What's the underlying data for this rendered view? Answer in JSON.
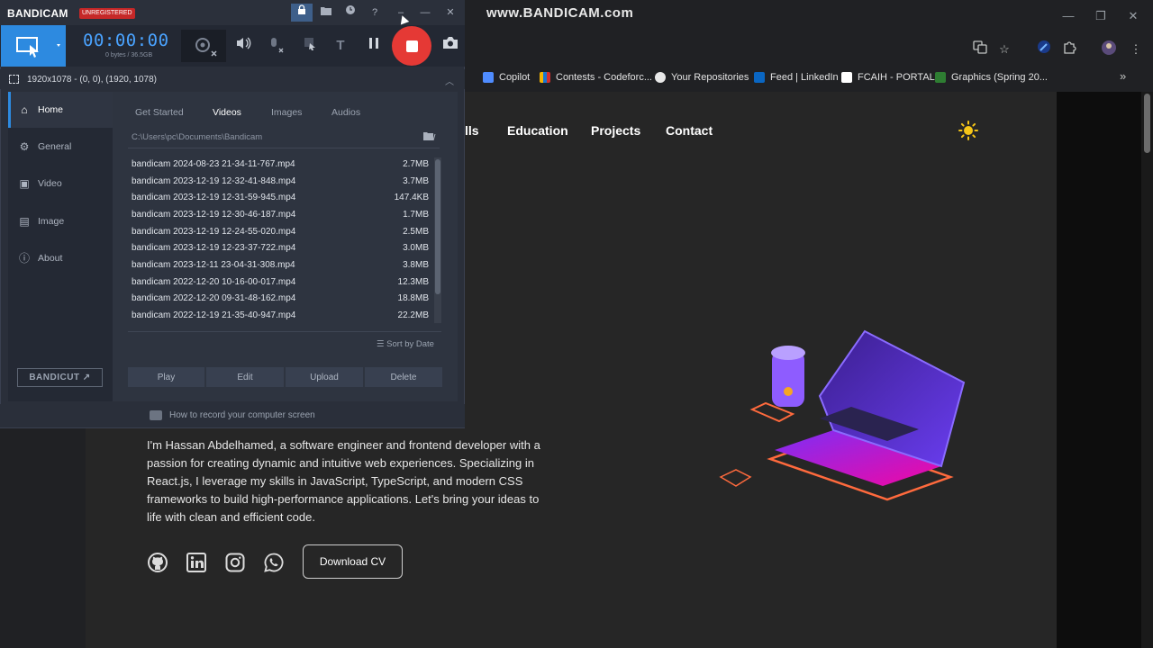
{
  "browser": {
    "watermark": "www.BANDICAM.com",
    "window_controls": [
      "—",
      "❐",
      "✕"
    ],
    "bookmarks": [
      {
        "label": "Copilot",
        "color": "#4f8cff"
      },
      {
        "label": "Contests - Codeforc...",
        "color": "#f5b400"
      },
      {
        "label": "Your Repositories",
        "color": "#e8e8e8"
      },
      {
        "label": "Feed | LinkedIn",
        "color": "#0a66c2"
      },
      {
        "label": "FCAIH - PORTAL",
        "color": "#ffffff"
      },
      {
        "label": "Graphics (Spring 20...",
        "color": "#2e7d32"
      }
    ],
    "bookmarks_more": "»"
  },
  "portfolio": {
    "nav": [
      "lls",
      "Education",
      "Projects",
      "Contact"
    ],
    "bio": "I'm Hassan Abdelhamed, a software engineer and frontend developer with a passion for creating dynamic and intuitive web experiences. Specializing in React.js, I leverage my skills in JavaScript, TypeScript, and modern CSS frameworks to build high-performance applications. Let's bring your ideas to life with clean and efficient code.",
    "social_icons": [
      "github-icon",
      "linkedin-icon",
      "instagram-icon",
      "whatsapp-icon"
    ],
    "download_label": "Download CV",
    "accent_color": "#f5c518"
  },
  "bandicam": {
    "logo": "BANDICAM",
    "unregistered": "UNREGISTERED",
    "timer": "00:00:00",
    "size": "0 bytes / 36.5GB",
    "area_label": "1920x1078 - (0, 0), (1920, 1078)",
    "sidebar": [
      {
        "label": "Home",
        "icon": "home-icon",
        "glyph": "⌂"
      },
      {
        "label": "General",
        "icon": "gear-icon",
        "glyph": "⚙"
      },
      {
        "label": "Video",
        "icon": "video-icon",
        "glyph": "▣"
      },
      {
        "label": "Image",
        "icon": "image-icon",
        "glyph": "▤"
      },
      {
        "label": "About",
        "icon": "info-icon",
        "glyph": "ⓘ"
      }
    ],
    "bandicut": "BANDICUT ↗",
    "tabs": [
      "Get Started",
      "Videos",
      "Images",
      "Audios"
    ],
    "active_tab": "Videos",
    "path": "C:\\Users\\pc\\Documents\\Bandicam",
    "files": [
      {
        "name": "bandicam 2024-08-23 21-34-11-767.mp4",
        "size": "2.7MB"
      },
      {
        "name": "bandicam 2023-12-19 12-32-41-848.mp4",
        "size": "3.7MB"
      },
      {
        "name": "bandicam 2023-12-19 12-31-59-945.mp4",
        "size": "147.4KB"
      },
      {
        "name": "bandicam 2023-12-19 12-30-46-187.mp4",
        "size": "1.7MB"
      },
      {
        "name": "bandicam 2023-12-19 12-24-55-020.mp4",
        "size": "2.5MB"
      },
      {
        "name": "bandicam 2023-12-19 12-23-37-722.mp4",
        "size": "3.0MB"
      },
      {
        "name": "bandicam 2023-12-11 23-04-31-308.mp4",
        "size": "3.8MB"
      },
      {
        "name": "bandicam 2022-12-20 10-16-00-017.mp4",
        "size": "12.3MB"
      },
      {
        "name": "bandicam 2022-12-20 09-31-48-162.mp4",
        "size": "18.8MB"
      },
      {
        "name": "bandicam 2022-12-19 21-35-40-947.mp4",
        "size": "22.2MB"
      }
    ],
    "sort_label": "Sort by Date",
    "actions": [
      "Play",
      "Edit",
      "Upload",
      "Delete"
    ],
    "footer": "How to record your computer screen"
  }
}
